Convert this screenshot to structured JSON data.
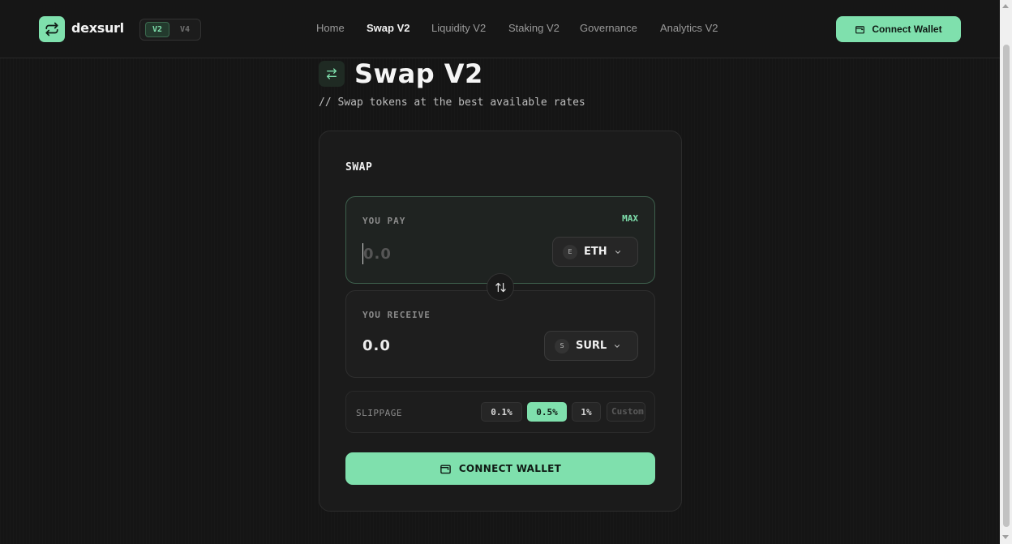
{
  "header": {
    "brand": "dexsurl",
    "versions": [
      "V2",
      "V4"
    ],
    "active_version": "V2",
    "nav": [
      {
        "label": "Home",
        "active": false
      },
      {
        "label": "Swap V2",
        "active": true
      },
      {
        "label": "Liquidity V2",
        "active": false
      },
      {
        "label": "Staking V2",
        "active": false
      },
      {
        "label": "Governance",
        "active": false
      },
      {
        "label": "Analytics V2",
        "active": false
      }
    ],
    "connect_label": "Connect Wallet"
  },
  "page": {
    "title": "Swap V2",
    "subtitle": "// Swap tokens at the best available rates"
  },
  "swap": {
    "card_title": "SWAP",
    "pay": {
      "label": "YOU PAY",
      "max_label": "MAX",
      "placeholder": "0.0",
      "token": "ETH",
      "token_badge": "E"
    },
    "receive": {
      "label": "YOU RECEIVE",
      "value": "0.0",
      "token": "SURL",
      "token_badge": "S"
    },
    "slippage": {
      "label": "SLIPPAGE",
      "options": [
        "0.1%",
        "0.5%",
        "1%"
      ],
      "selected": "0.5%",
      "custom_placeholder": "Custom"
    },
    "connect_label": "CONNECT WALLET"
  },
  "colors": {
    "accent": "#7fe0ad",
    "background": "#151515",
    "card": "#1b1b1b"
  },
  "icons": {
    "logo": "swap-arrows-icon",
    "wallet": "wallet-icon",
    "chevron": "chevron-down-icon",
    "swap_direction": "swap-vertical-icon"
  }
}
